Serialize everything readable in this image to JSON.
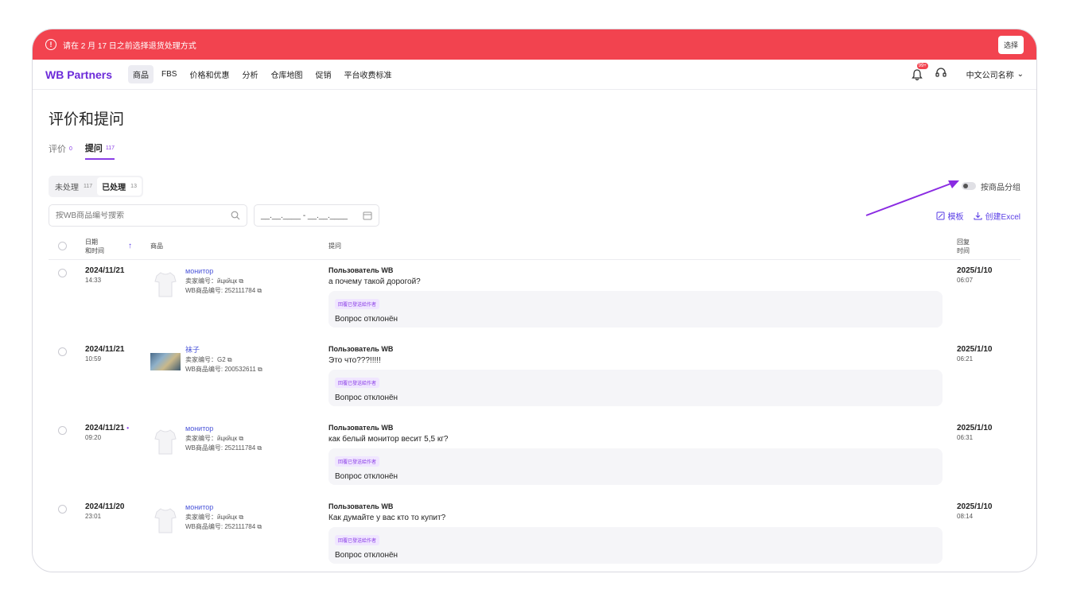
{
  "banner": {
    "text": "请在 2 月 17 日之前选择退货处理方式",
    "button": "选择"
  },
  "nav": {
    "logo": "WB Partners",
    "items": [
      "商品",
      "FBS",
      "价格和优惠",
      "分析",
      "仓库地图",
      "促销",
      "平台收费标准"
    ],
    "active_index": 0,
    "notif_badge": "99+",
    "company": "中文公司名称"
  },
  "page": {
    "title": "评价和提问",
    "tabs": [
      {
        "label": "评价",
        "count": "0"
      },
      {
        "label": "提问",
        "count": "117"
      }
    ],
    "segments": [
      {
        "label": "未处理",
        "count": "117"
      },
      {
        "label": "已处理",
        "count": "13"
      }
    ],
    "group_toggle": "按商品分组",
    "search_placeholder": "按WB商品编号搜索",
    "date_range": "__.__.____ - __.__.____",
    "actions": {
      "template": "模板",
      "excel": "创建Excel"
    }
  },
  "table": {
    "headers": {
      "date_l1": "日期",
      "date_l2": "和时间",
      "product": "商品",
      "question": "提问",
      "answer_l1": "回复",
      "answer_l2": "时间"
    },
    "rows": [
      {
        "date": "2024/11/21",
        "time": "14:33",
        "dot": false,
        "product_name": "монитор",
        "seller_code": "卖家编号：йцкйцк",
        "wb_code": "WB商品编号: 252111784",
        "thumb": "tshirt",
        "user": "Пользователь WB",
        "question": "а почему такой дорогой?",
        "reply_tag": "回覆已發送給作者",
        "reply": "Вопрос отклонён",
        "answer_date": "2025/1/10",
        "answer_time": "06:07"
      },
      {
        "date": "2024/11/21",
        "time": "10:59",
        "dot": false,
        "product_name": "袜子",
        "seller_code": "卖家编号：G2",
        "wb_code": "WB商品编号: 200532611",
        "thumb": "photo",
        "user": "Пользователь WB",
        "question": "Это что???!!!!!",
        "reply_tag": "回覆已發送給作者",
        "reply": "Вопрос отклонён",
        "answer_date": "2025/1/10",
        "answer_time": "06:21"
      },
      {
        "date": "2024/11/21",
        "time": "09:20",
        "dot": true,
        "product_name": "монитор",
        "seller_code": "卖家编号：йцкйцк",
        "wb_code": "WB商品编号: 252111784",
        "thumb": "tshirt",
        "user": "Пользователь WB",
        "question": "как белый монитор весит 5,5 кг?",
        "reply_tag": "回覆已發送給作者",
        "reply": "Вопрос отклонён",
        "answer_date": "2025/1/10",
        "answer_time": "06:31"
      },
      {
        "date": "2024/11/20",
        "time": "23:01",
        "dot": false,
        "product_name": "монитор",
        "seller_code": "卖家编号：йцкйцк",
        "wb_code": "WB商品编号: 252111784",
        "thumb": "tshirt",
        "user": "Пользователь WB",
        "question": "Как думайте у вас кто то купит?",
        "reply_tag": "回覆已發送給作者",
        "reply": "Вопрос отклонён",
        "answer_date": "2025/1/10",
        "answer_time": "08:14"
      }
    ]
  },
  "colors": {
    "banner": "#f2434f",
    "accent": "#8a3ee6",
    "link": "#4b55d9"
  }
}
